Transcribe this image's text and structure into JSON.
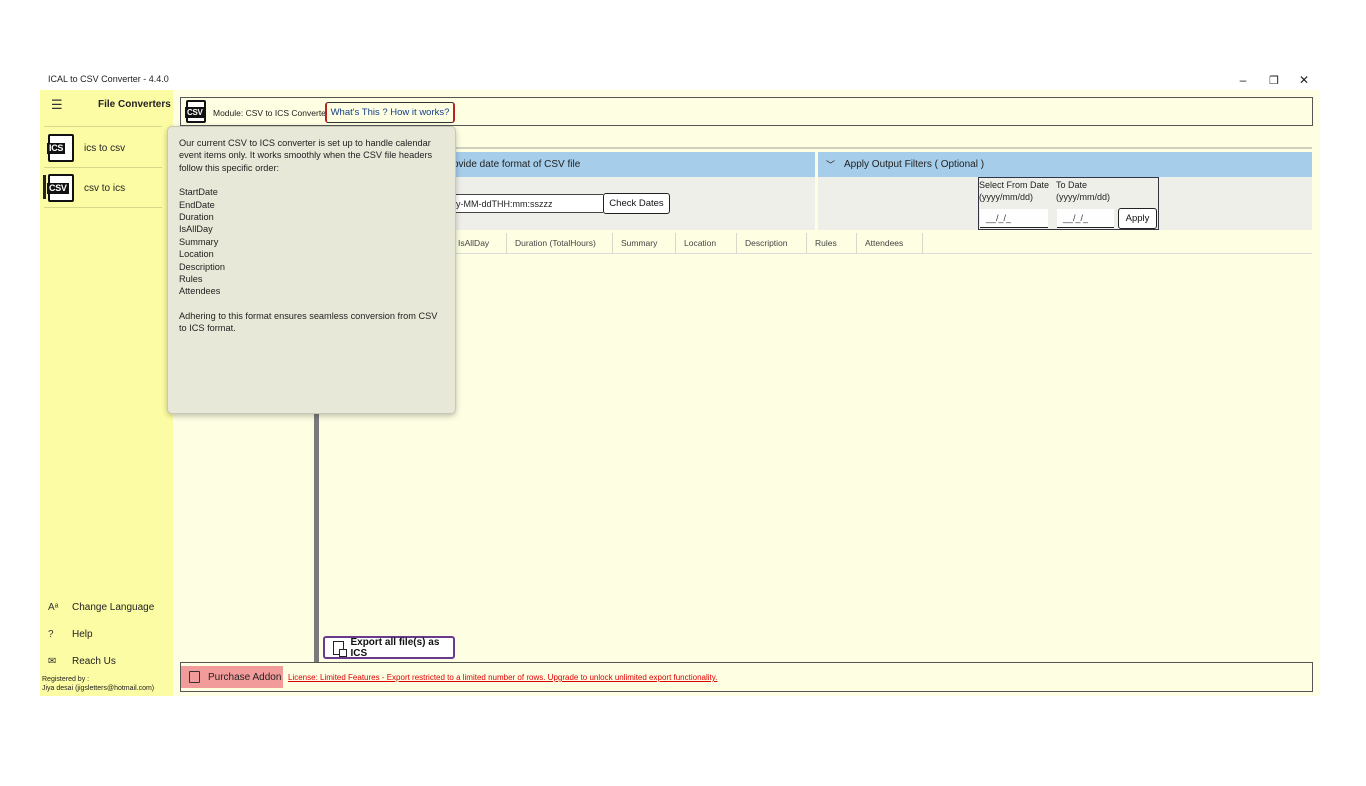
{
  "window": {
    "title": "ICAL to CSV Converter -  4.4.0",
    "controls": {
      "minimize": "–",
      "restore": "❐",
      "close": "✕"
    }
  },
  "sidebar": {
    "menu_icon": "☰",
    "title": "File Converters",
    "items": [
      {
        "label": "ics to csv",
        "icon": "ICS",
        "selected": false
      },
      {
        "label": "csv to ics",
        "icon": "CSV",
        "selected": true
      }
    ],
    "bottom": [
      {
        "label": "Change Language",
        "icon": "translate-icon",
        "glyph": "Aᵃ"
      },
      {
        "label": "Help",
        "icon": "help-icon",
        "glyph": "?"
      },
      {
        "label": "Reach Us",
        "icon": "mail-icon",
        "glyph": "✉"
      }
    ],
    "registered_label": "Registered by :",
    "registered_user": "Jiya desai (jigsletters@hotmail.com)"
  },
  "module": {
    "icon": "CSV",
    "label": "Module: CSV to ICS Converter",
    "help_button": "What's This ? How it works?"
  },
  "date_format": {
    "header": "ovide date format of CSV file",
    "value": "y-MM-ddTHH:mm:sszzz",
    "check_button": "Check Dates"
  },
  "filters": {
    "header": "Apply Output Filters ( Optional )",
    "from_label": "Select From Date (yyyy/mm/dd)",
    "to_label": "To Date (yyyy/mm/dd)",
    "from_value": "__/_/_",
    "to_value": "__/_/_",
    "apply_button": "Apply"
  },
  "table": {
    "columns": [
      "IsAllDay",
      "Duration (TotalHours)",
      "Summary",
      "Location",
      "Description",
      "Rules",
      "Attendees"
    ]
  },
  "tooltip": {
    "intro": "Our current CSV to ICS converter is set up to handle calendar event items only. It works smoothly when the CSV file headers follow this specific order:",
    "fields": [
      "StartDate",
      "EndDate",
      "Duration",
      "IsAllDay",
      "Summary",
      "Location",
      "Description",
      "Rules",
      "Attendees"
    ],
    "outro": "Adhering to this format ensures seamless conversion from CSV to ICS format."
  },
  "export_button": "Export all file(s) as ICS",
  "purchase_button": "Purchase Addon",
  "license_text": "License: Limited Features - Export restricted to a limited number of rows. Upgrade to unlock unlimited export functionality."
}
